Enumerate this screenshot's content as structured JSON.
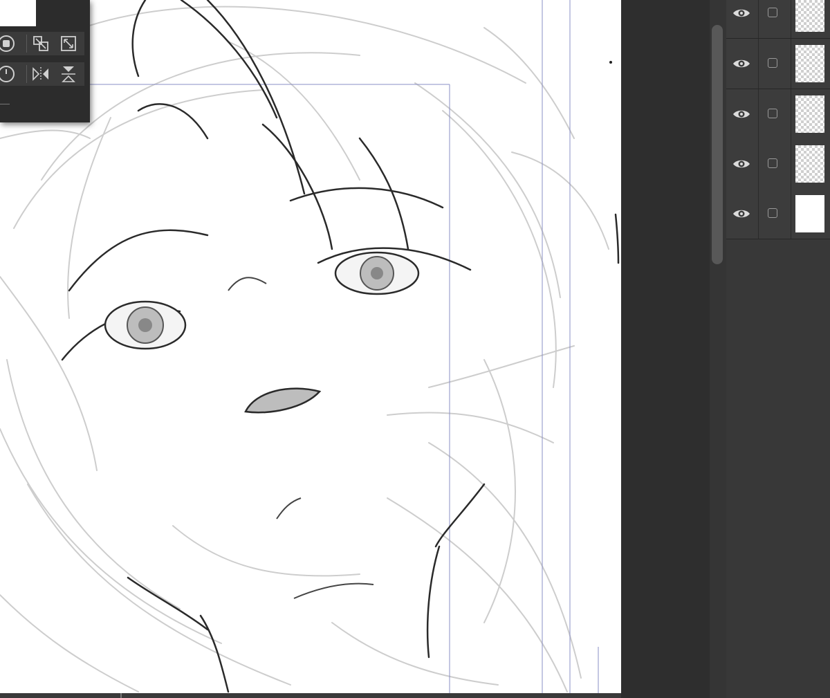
{
  "app": {
    "type": "digital painting canvas"
  },
  "tool_palette": {
    "tools": [
      {
        "icon": "stop-circle-icon",
        "row": 1
      },
      {
        "icon": "resize-arrows-icon",
        "row": 1
      },
      {
        "icon": "expand-icon",
        "row": 1
      },
      {
        "icon": "rotate-dial-icon",
        "row": 2
      },
      {
        "icon": "flip-horizontal-icon",
        "row": 2
      },
      {
        "icon": "flip-vertical-icon",
        "row": 2
      }
    ]
  },
  "layers": [
    {
      "visible": true,
      "selected": false,
      "thumbnail": "transparent"
    },
    {
      "visible": true,
      "selected": false,
      "thumbnail": "transparent"
    },
    {
      "visible": true,
      "selected": false,
      "thumbnail": "transparent"
    },
    {
      "visible": true,
      "selected": false,
      "thumbnail": "transparent"
    },
    {
      "visible": true,
      "selected": false,
      "thumbnail": "white"
    }
  ],
  "colors": {
    "canvas": "#ffffff",
    "panel": "#383838",
    "workspace": "#2e2e2e",
    "guide_line": "#8a8fc4",
    "ink": "#2a2a2a",
    "sketch": "#c8c8c8"
  }
}
